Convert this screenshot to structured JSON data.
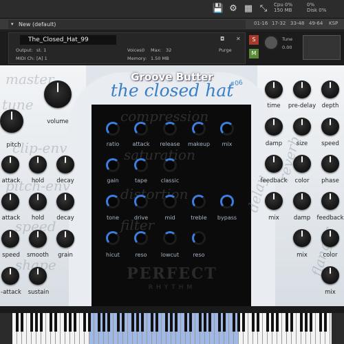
{
  "toolbar": {
    "save_icon": "save-icon",
    "gear_icon": "gear-icon",
    "resize_icon": "resize-icon",
    "cpu_label": "Cpu",
    "cpu_value": "0%",
    "mem_value": "150 MB",
    "disk_label": "Disk",
    "disk_value": "0%"
  },
  "multi": {
    "name": "New (default)",
    "tabs": [
      "01-16",
      "17-32",
      "33-48",
      "49-64",
      "KSP"
    ]
  },
  "instrument": {
    "name": "The_Closed_Hat_99",
    "output_label": "Output:",
    "output_value": "st. 1",
    "voices_label": "Voices:",
    "voices_value": "0",
    "max_label": "Max:",
    "max_value": "32",
    "purge_label": "Purge",
    "midi_label": "MIDI Ch:",
    "midi_value": "[A] 1",
    "memory_label": "Memory:",
    "memory_value": "1.50 MB",
    "solo": "S",
    "mute": "M",
    "tune_label": "Tune",
    "tune_value": "0.00"
  },
  "panel": {
    "brand": "Groove Butter",
    "subtitle": "the closed hat",
    "version": "#06",
    "ghost_left": [
      "master",
      "tune",
      "clip-env",
      "pitch-env",
      "speed",
      "shape"
    ],
    "ghost_center": [
      "compression",
      "saturation",
      "distortion",
      "filter"
    ],
    "ghost_right": [
      "delay",
      "reverb",
      "flanger"
    ],
    "logo_line1": "PERFECT",
    "logo_line2": "RHYTHM"
  },
  "left_knobs": {
    "master_volume": "volume",
    "pitch": "pitch",
    "clip_attack": "attack",
    "clip_hold": "hold",
    "clip_decay": "decay",
    "pitch_attack": "attack",
    "pitch_hold": "hold",
    "pitch_decay": "decay",
    "speed": "speed",
    "smooth": "smooth",
    "grain": "grain",
    "shape_attack": "-attack",
    "sustain": "sustain"
  },
  "center_knobs": {
    "ratio": "ratio",
    "attack": "attack",
    "release": "release",
    "makeup": "makeup",
    "mix": "mix",
    "gain": "gain",
    "tape": "tape",
    "classic": "classic",
    "tone": "tone",
    "drive": "drive",
    "mid": "mid",
    "treble": "treble",
    "bypass": "bypass",
    "hicut": "hicut",
    "reso1": "reso",
    "lowcut": "lowcut",
    "reso2": "reso"
  },
  "right_knobs": {
    "time": "time",
    "predelay": "pre-delay",
    "depth": "depth",
    "damp1": "damp",
    "size": "size",
    "speed": "speed",
    "feedback1": "feedback",
    "color1": "color",
    "phase": "phase",
    "mix1": "mix",
    "damp2": "damp",
    "feedback2": "feedback",
    "mix2": "mix",
    "color2": "color",
    "mix3": "mix"
  },
  "colors": {
    "accent": "#3d7fe0",
    "subtitle": "#3a7fc4",
    "keyboard_highlight": "#9fb8e6"
  }
}
